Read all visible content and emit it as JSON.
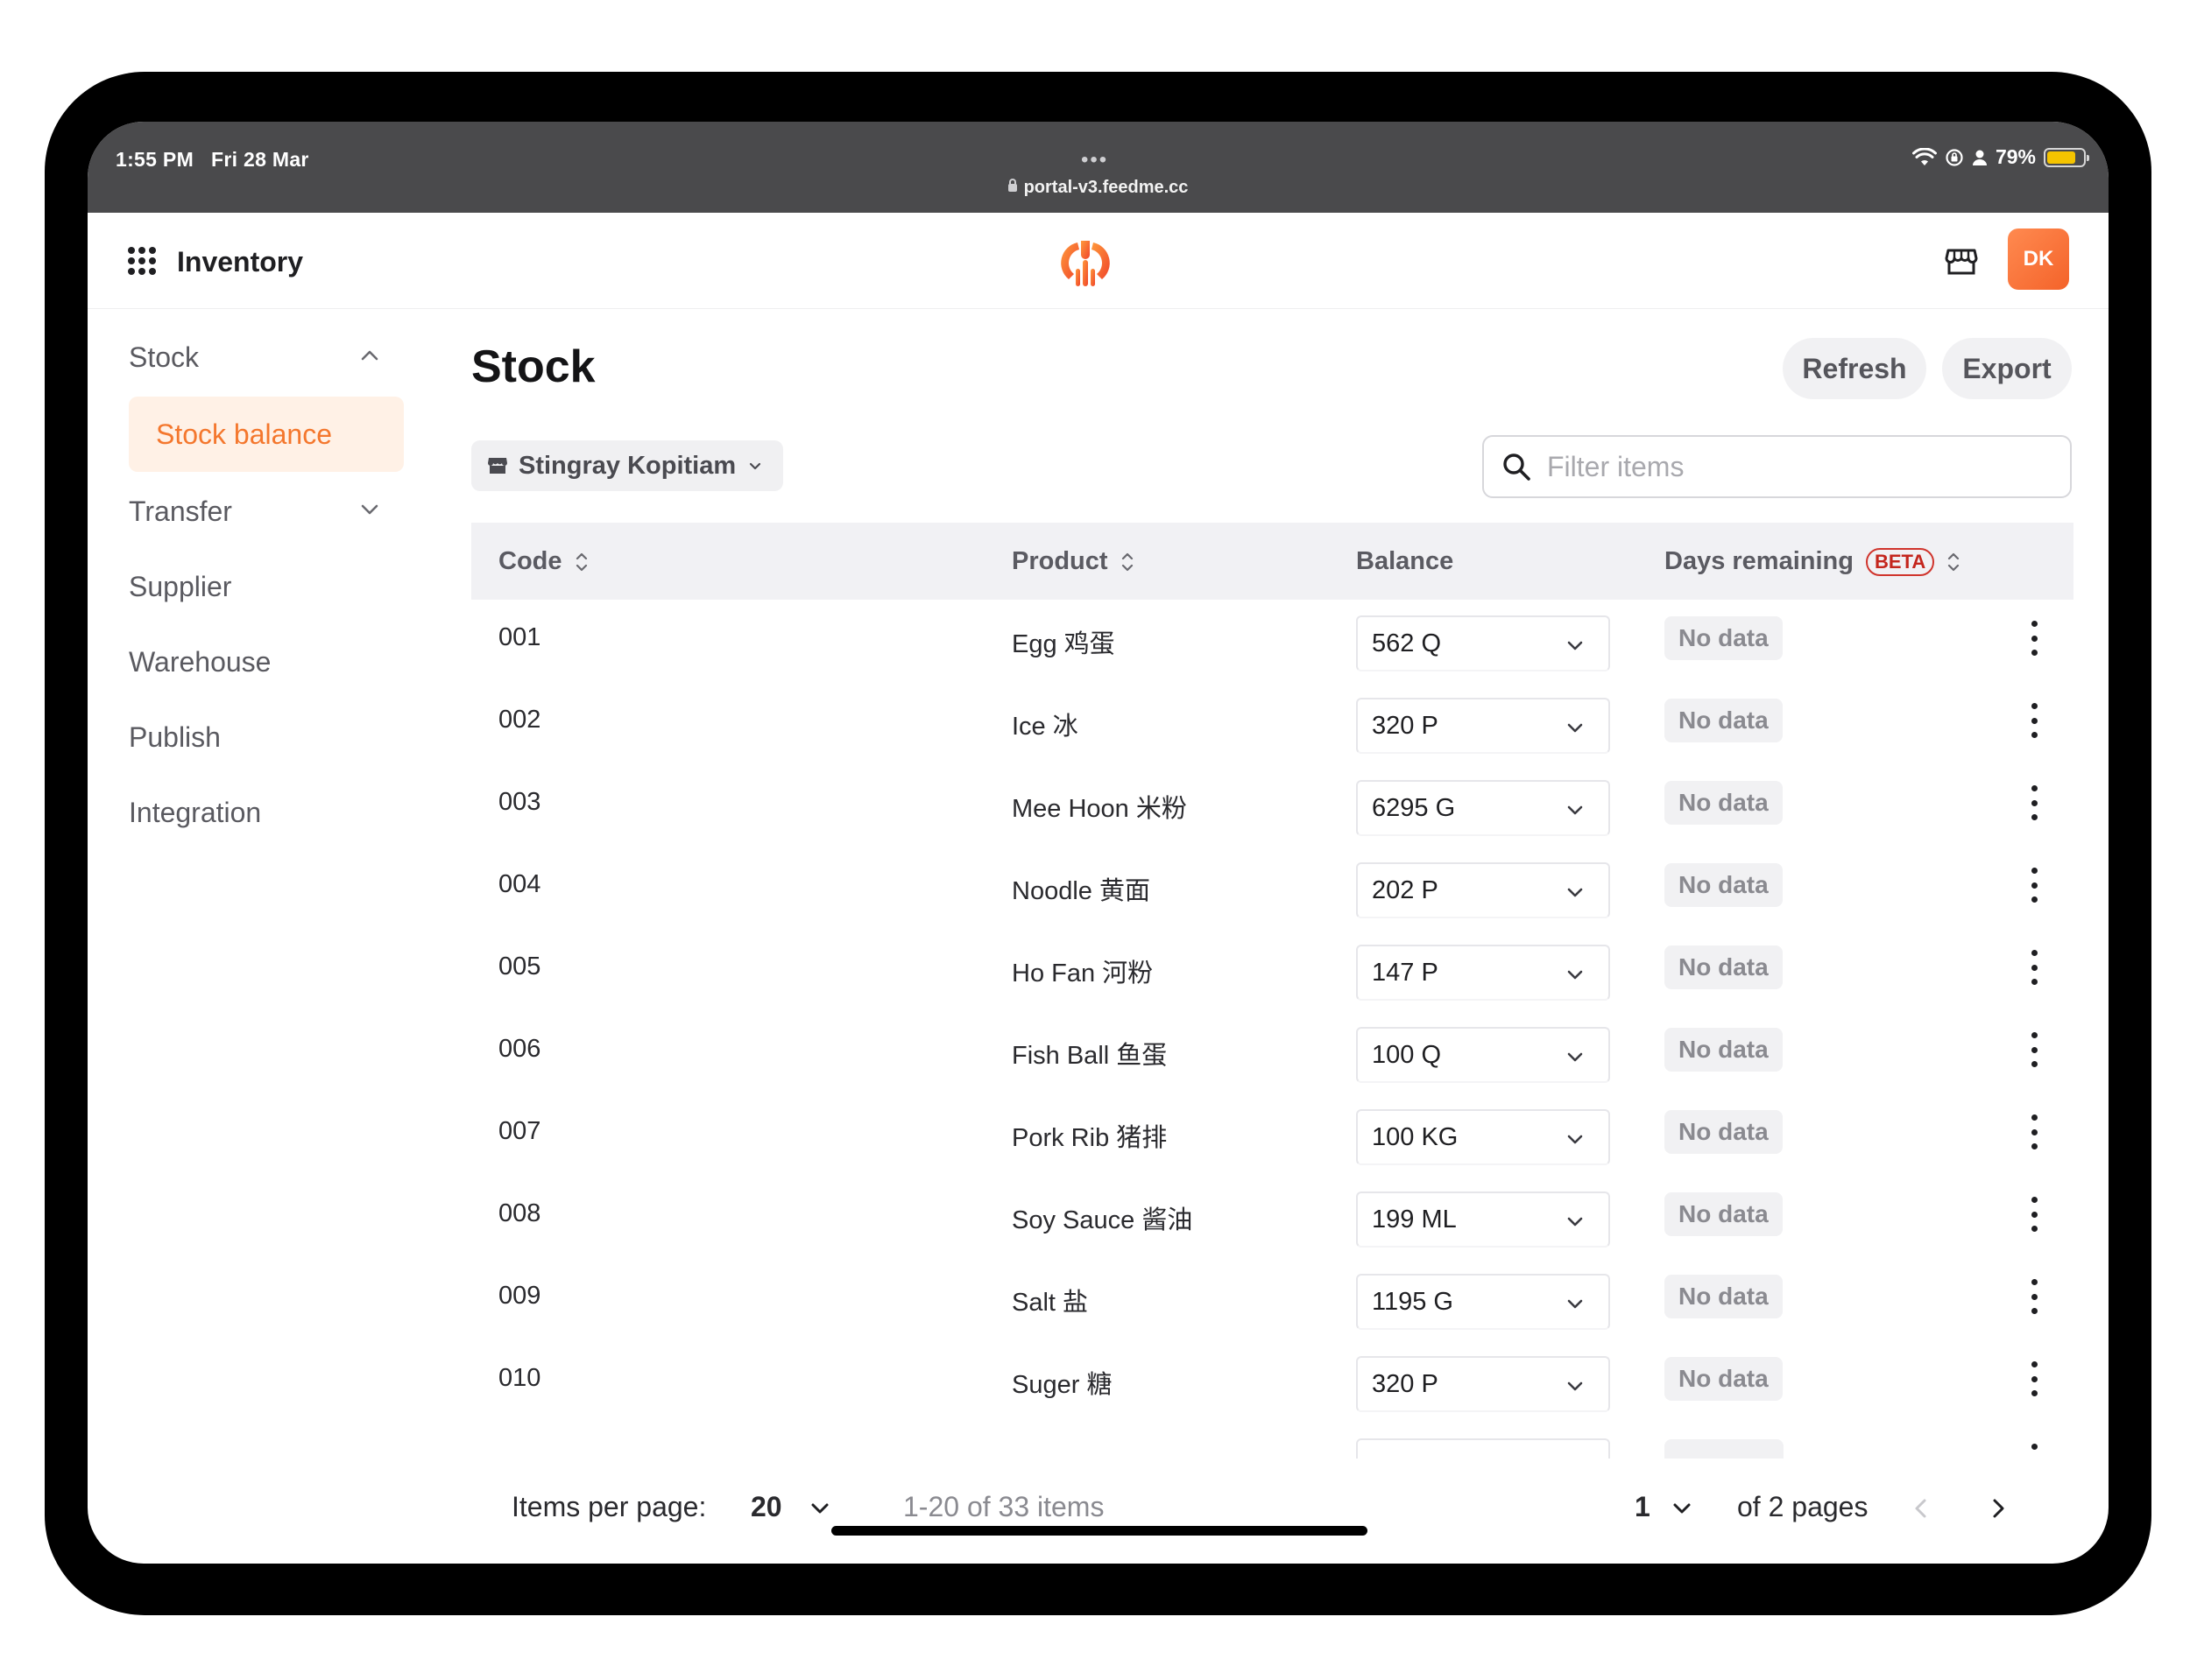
{
  "status_bar": {
    "time": "1:55 PM",
    "date": "Fri 28 Mar",
    "url": "portal-v3.feedme.cc",
    "battery": "79%",
    "battery_level": 0.79
  },
  "header": {
    "app_title": "Inventory",
    "avatar_initials": "DK"
  },
  "sidebar": {
    "items": [
      {
        "label": "Stock",
        "expanded": true
      },
      {
        "label": "Stock balance",
        "active": true
      },
      {
        "label": "Transfer",
        "expanded": false
      },
      {
        "label": "Supplier"
      },
      {
        "label": "Warehouse"
      },
      {
        "label": "Publish"
      },
      {
        "label": "Integration"
      }
    ]
  },
  "main": {
    "title": "Stock",
    "refresh_label": "Refresh",
    "export_label": "Export",
    "location": "Stingray Kopitiam",
    "filter_placeholder": "Filter items"
  },
  "table": {
    "columns": {
      "code": "Code",
      "product": "Product",
      "balance": "Balance",
      "days_remaining": "Days remaining",
      "beta": "BETA"
    },
    "rows": [
      {
        "code": "001",
        "product": "Egg 鸡蛋",
        "balance": "562 Q",
        "days": "No data"
      },
      {
        "code": "002",
        "product": "Ice 冰",
        "balance": "320 P",
        "days": "No data"
      },
      {
        "code": "003",
        "product": "Mee Hoon 米粉",
        "balance": "6295 G",
        "days": "No data"
      },
      {
        "code": "004",
        "product": "Noodle 黄面",
        "balance": "202 P",
        "days": "No data"
      },
      {
        "code": "005",
        "product": "Ho Fan 河粉",
        "balance": "147 P",
        "days": "No data"
      },
      {
        "code": "006",
        "product": "Fish Ball 鱼蛋",
        "balance": "100 Q",
        "days": "No data"
      },
      {
        "code": "007",
        "product": "Pork Rib 猪排",
        "balance": "100 KG",
        "days": "No data"
      },
      {
        "code": "008",
        "product": "Soy Sauce 酱油",
        "balance": "199 ML",
        "days": "No data"
      },
      {
        "code": "009",
        "product": "Salt 盐",
        "balance": "1195 G",
        "days": "No data"
      },
      {
        "code": "010",
        "product": "Suger 糖",
        "balance": "320 P",
        "days": "No data"
      }
    ]
  },
  "pagination": {
    "items_per_page_label": "Items per page:",
    "items_per_page": "20",
    "range": "1-20 of 33 items",
    "page": "1",
    "of_pages": "of 2 pages"
  }
}
